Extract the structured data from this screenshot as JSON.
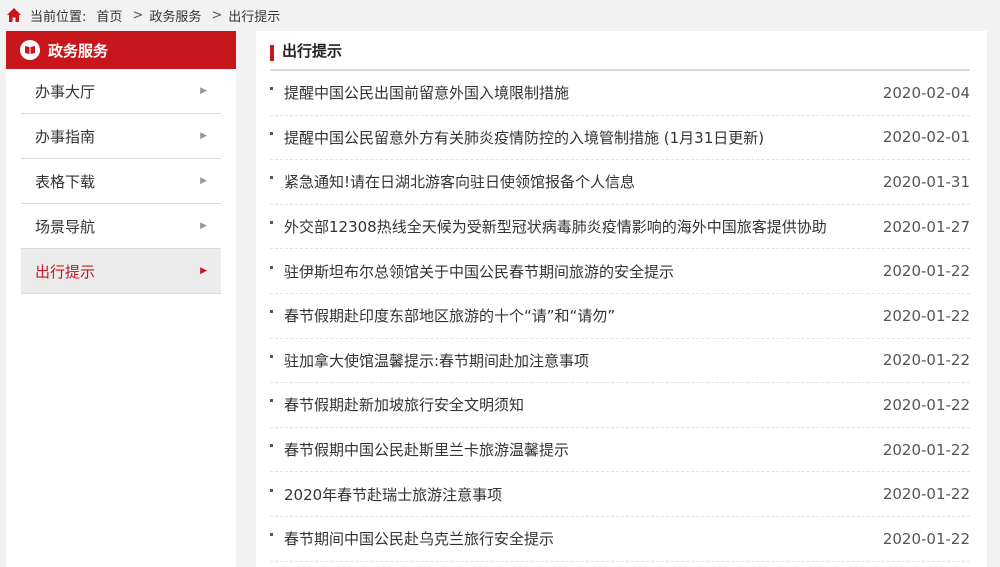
{
  "breadcrumb": {
    "label": "当前位置:",
    "items": [
      "首页",
      "政务服务",
      "出行提示"
    ],
    "separator": ">"
  },
  "sidebar": {
    "title": "政务服务",
    "items": [
      {
        "label": "办事大厅",
        "arrow": "▶"
      },
      {
        "label": "办事指南",
        "arrow": "▶"
      },
      {
        "label": "表格下载",
        "arrow": "▶"
      },
      {
        "label": "场景导航",
        "arrow": "▶"
      },
      {
        "label": "出行提示",
        "arrow": "▶"
      }
    ]
  },
  "main": {
    "title": "出行提示",
    "news": [
      {
        "title": "提醒中国公民出国前留意外国入境限制措施",
        "date": "2020-02-04"
      },
      {
        "title": "提醒中国公民留意外方有关肺炎疫情防控的入境管制措施 (1月31日更新)",
        "date": "2020-02-01"
      },
      {
        "title": "紧急通知!请在日湖北游客向驻日使领馆报备个人信息",
        "date": "2020-01-31"
      },
      {
        "title": "外交部12308热线全天候为受新型冠状病毒肺炎疫情影响的海外中国旅客提供协助",
        "date": "2020-01-27"
      },
      {
        "title": "驻伊斯坦布尔总领馆关于中国公民春节期间旅游的安全提示",
        "date": "2020-01-22"
      },
      {
        "title": "春节假期赴印度东部地区旅游的十个“请”和“请勿”",
        "date": "2020-01-22"
      },
      {
        "title": "驻加拿大使馆温馨提示:春节期间赴加注意事项",
        "date": "2020-01-22"
      },
      {
        "title": "春节假期赴新加坡旅行安全文明须知",
        "date": "2020-01-22"
      },
      {
        "title": "春节假期中国公民赴斯里兰卡旅游温馨提示",
        "date": "2020-01-22"
      },
      {
        "title": "2020年春节赴瑞士旅游注意事项",
        "date": "2020-01-22"
      },
      {
        "title": "春节期间中国公民赴乌克兰旅行安全提示",
        "date": "2020-01-22"
      }
    ]
  },
  "colors": {
    "accent": "#c8161d",
    "background": "#f2f2f2"
  }
}
